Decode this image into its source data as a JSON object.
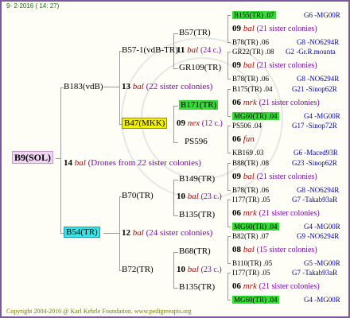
{
  "header": {
    "date": "9-  2-2016 ( 14: 27)"
  },
  "footer": {
    "text": "Copyright 2004-2016 @ Karl Kehrle Foundation.   www.pedigreeapis.org"
  },
  "root": {
    "name": "B9(SOL)"
  },
  "gen1": {
    "left": "B183(vdB)",
    "right": "B54(TR)",
    "num": "14",
    "bal": "bal",
    "drones": "(Drones from 22 sister colonies)"
  },
  "gen2": {
    "a": {
      "top": "B57-1(vdB-TR)",
      "bottom": "B47(MKK)",
      "num": "13",
      "bal": "bal",
      "sis": "(22 sister colonies)"
    },
    "b": {
      "top": "B70(TR)",
      "bottom": "B72(TR)",
      "num": "12",
      "bal": "bal",
      "sis": "(24 sister colonies)"
    }
  },
  "gen3": [
    {
      "top": "B57(TR)",
      "bottom": "GR109(TR)",
      "num": "11",
      "bal": "bal",
      "c": "(24 c.)"
    },
    {
      "top": "B171(TR)",
      "bottom": "PS596",
      "num": "09",
      "bal": "nex",
      "c": "(12 c.)"
    },
    {
      "top": "B149(TR)",
      "bottom": "B135(TR)",
      "num": "10",
      "bal": "bal",
      "c": "(23 c.)"
    },
    {
      "top": "B68(TR)",
      "bottom": "B135(TR)",
      "num": "10",
      "bal": "bal",
      "c": "(23 c.)"
    }
  ],
  "leaves": [
    {
      "top": "B155(TR) .07",
      "topr": "G6 -MG00R",
      "num": "09",
      "bal": "bal",
      "sis": "(21 sister colonies)",
      "bot": "B78(TR) .06",
      "botr": "G8 -NO6294R"
    },
    {
      "top": "GR22(TR) .08",
      "topr": "G2 -Gr.R.mounta",
      "num": "09",
      "bal": "bal",
      "sis": "(21 sister colonies)",
      "bot": "B78(TR) .06",
      "botr": "G8 -NO6294R"
    },
    {
      "top": "B175(TR) .04",
      "topr": "G21 -Sinop62R",
      "num": "06",
      "bal": "mrk",
      "sis": "(21 sister colonies)",
      "bot": "MG60(TR) .04",
      "botr": "G4 -MG00R"
    },
    {
      "top": "PS506 .04",
      "topr": "G17 -Sinop72R",
      "num": "06",
      "bal": "fun",
      "sis": "",
      "bot": "KB169 .03",
      "botr": "G6 -Maced93R"
    },
    {
      "top": "B88(TR) .08",
      "topr": "G23 -Sinop62R",
      "num": "09",
      "bal": "bal",
      "sis": "(21 sister colonies)",
      "bot": "B78(TR) .06",
      "botr": "G8 -NO6294R"
    },
    {
      "top": "I177(TR) .05",
      "topr": "G7 -Takab93aR",
      "num": "06",
      "bal": "mrk",
      "sis": "(21 sister colonies)",
      "bot": "MG60(TR) .04",
      "botr": "G4 -MG00R"
    },
    {
      "top": "B82(TR) .07",
      "topr": "G9 -NO6294R",
      "num": "08",
      "bal": "bal",
      "sis": "(15 sister colonies)",
      "bot": "B110(TR) .05",
      "botr": "G5 -MG00R"
    },
    {
      "top": "I177(TR) .05",
      "topr": "G7 -Takab93aR",
      "num": "06",
      "bal": "mrk",
      "sis": "(21 sister colonies)",
      "bot": "MG60(TR) .04",
      "botr": "G4 -MG00R"
    }
  ]
}
